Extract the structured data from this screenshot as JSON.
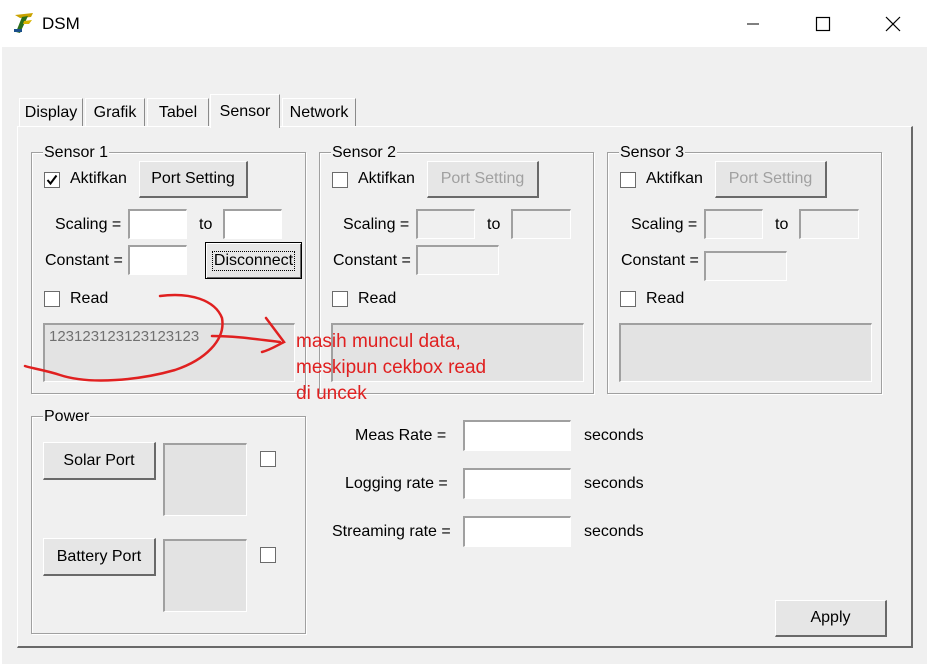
{
  "window": {
    "title": "DSM"
  },
  "tabs": [
    "Display",
    "Grafik",
    "Tabel",
    "Sensor",
    "Network"
  ],
  "active_tab": "Sensor",
  "sensor1": {
    "title": "Sensor 1",
    "aktifkan_label": "Aktifkan",
    "aktifkan_checked": true,
    "port_setting_label": "Port Setting",
    "scaling_label": "Scaling =",
    "to_label": "to",
    "scaling_from": "",
    "scaling_to": "",
    "constant_label": "Constant =",
    "constant_value": "",
    "disconnect_label": "Disconnect",
    "read_label": "Read",
    "read_checked": false,
    "data_text": "123123123123123123"
  },
  "sensor2": {
    "title": "Sensor 2",
    "aktifkan_label": "Aktifkan",
    "port_setting_label": "Port Setting",
    "scaling_label": "Scaling =",
    "to_label": "to",
    "constant_label": "Constant =",
    "read_label": "Read"
  },
  "sensor3": {
    "title": "Sensor 3",
    "aktifkan_label": "Aktifkan",
    "port_setting_label": "Port Setting",
    "scaling_label": "Scaling =",
    "to_label": "to",
    "constant_label": "Constant =",
    "read_label": "Read"
  },
  "power": {
    "title": "Power",
    "solar_port_label": "Solar Port",
    "battery_port_label": "Battery Port"
  },
  "rates": {
    "meas_rate_label": "Meas Rate =",
    "logging_rate_label": "Logging rate =",
    "streaming_rate_label": "Streaming rate =",
    "unit": "seconds"
  },
  "apply_label": "Apply",
  "annotation": {
    "text": "masih muncul data,\nmeskipun cekbox read\ndi uncek",
    "color": "#e02020"
  }
}
